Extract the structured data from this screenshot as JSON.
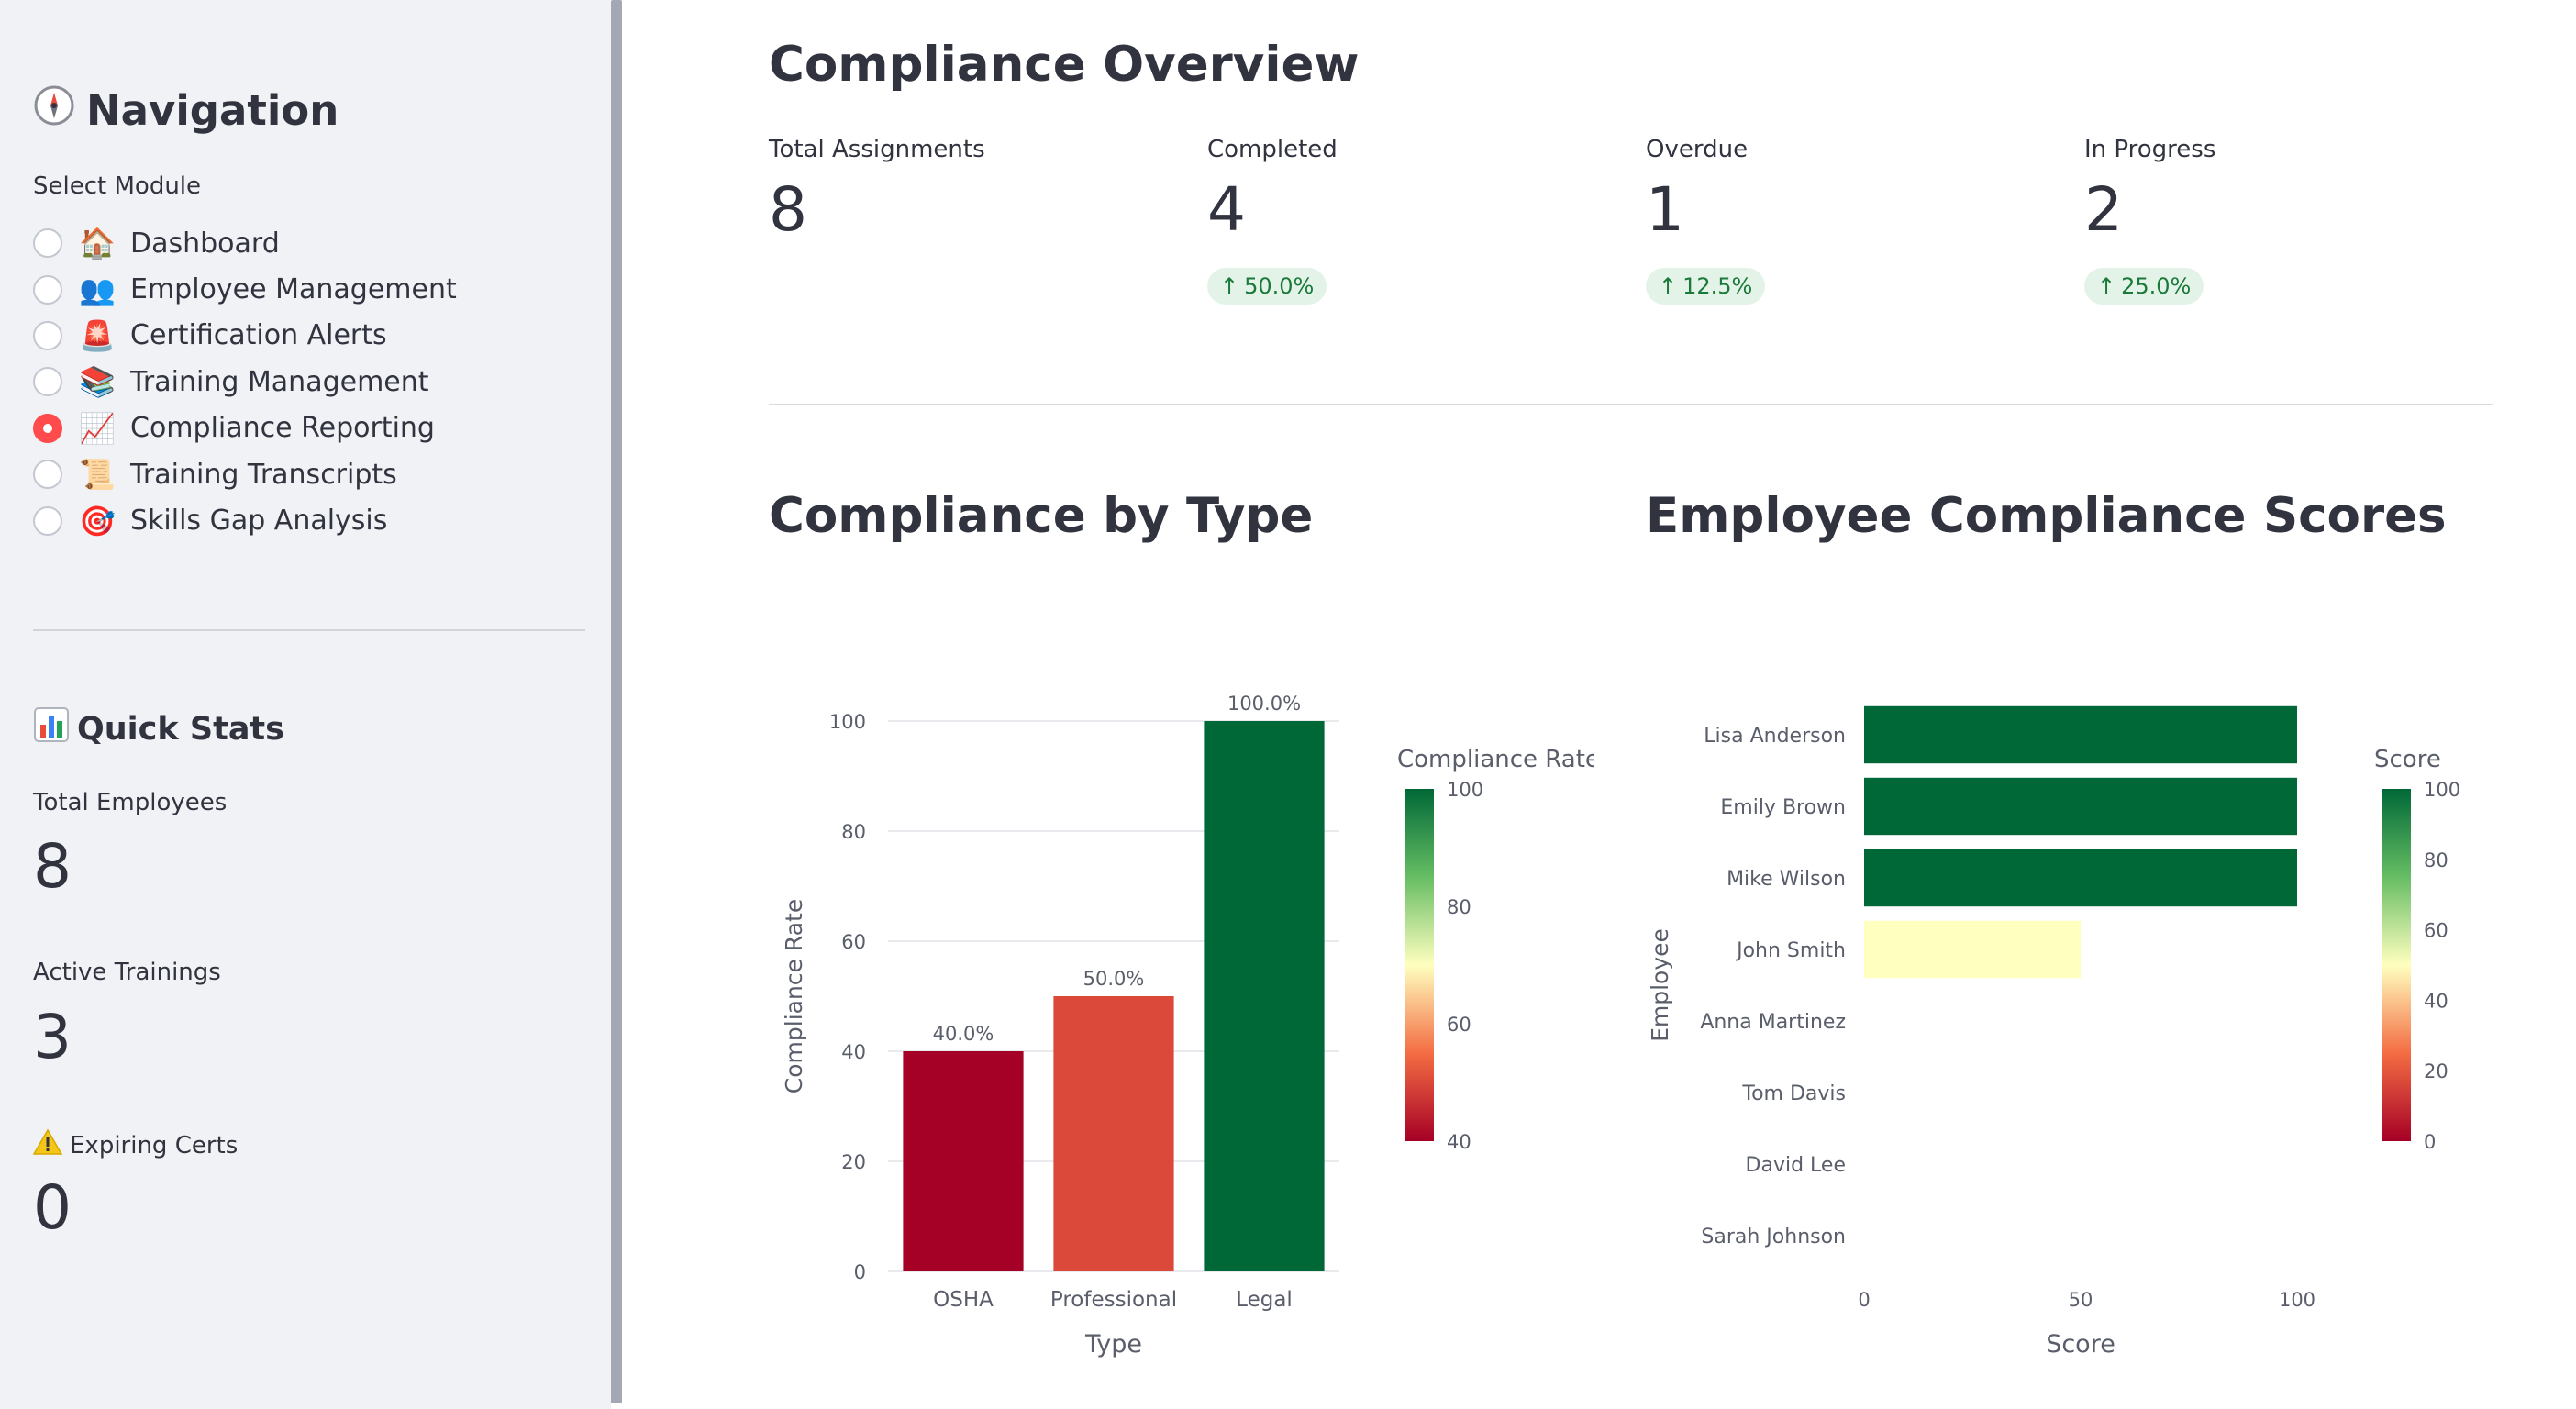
{
  "sidebar": {
    "title": "Navigation",
    "title_icon": "compass-icon",
    "select_label": "Select Module",
    "modules": [
      {
        "label": "Dashboard",
        "icon": "🏠",
        "selected": false
      },
      {
        "label": "Employee Management",
        "icon": "👥",
        "selected": false
      },
      {
        "label": "Certification Alerts",
        "icon": "🚨",
        "selected": false
      },
      {
        "label": "Training Management",
        "icon": "📚",
        "selected": false
      },
      {
        "label": "Compliance Reporting",
        "icon": "📈",
        "selected": true
      },
      {
        "label": "Training Transcripts",
        "icon": "📜",
        "selected": false
      },
      {
        "label": "Skills Gap Analysis",
        "icon": "🎯",
        "selected": false
      }
    ],
    "quick_stats": {
      "title": "Quick Stats",
      "title_icon": "bar-chart-icon",
      "total_employees_label": "Total Employees",
      "total_employees_value": "8",
      "active_trainings_label": "Active Trainings",
      "active_trainings_value": "3",
      "expiring_certs_label": "Expiring Certs",
      "expiring_certs_icon": "warning-icon",
      "expiring_certs_value": "0"
    }
  },
  "main": {
    "title": "Compliance Overview",
    "metrics": [
      {
        "label": "Total Assignments",
        "value": "8",
        "delta": ""
      },
      {
        "label": "Completed",
        "value": "4",
        "delta": "50.0%"
      },
      {
        "label": "Overdue",
        "value": "1",
        "delta": "12.5%"
      },
      {
        "label": "In Progress",
        "value": "2",
        "delta": "25.0%"
      }
    ],
    "section_type_title": "Compliance by Type",
    "section_scores_title": "Employee Compliance Scores"
  },
  "colors": {
    "accent": "#ff4b4b",
    "delta_bg": "#e4f3e8",
    "delta_text": "#1b7a3a"
  },
  "chart_data": [
    {
      "type": "bar",
      "orientation": "vertical",
      "categories": [
        "OSHA",
        "Professional",
        "Legal"
      ],
      "values": [
        40,
        50,
        100
      ],
      "data_labels": [
        "40.0%",
        "50.0%",
        "100.0%"
      ],
      "xlabel": "Type",
      "ylabel": "Compliance Rate",
      "ylim": [
        0,
        100
      ],
      "yticks": [
        0,
        20,
        40,
        60,
        80,
        100
      ],
      "grid": true,
      "colorbar": {
        "title": "Compliance Rate",
        "range": [
          40,
          100
        ],
        "ticks": [
          40,
          60,
          80,
          100
        ],
        "colorscale": "RdYlGn",
        "placement": "right"
      }
    },
    {
      "type": "bar",
      "orientation": "horizontal",
      "categories": [
        "Lisa Anderson",
        "Emily Brown",
        "Mike Wilson",
        "John Smith",
        "Anna Martinez",
        "Tom Davis",
        "David Lee",
        "Sarah Johnson"
      ],
      "values": [
        100,
        100,
        100,
        50,
        0,
        0,
        0,
        0
      ],
      "xlabel": "Score",
      "ylabel": "Employee",
      "xlim": [
        0,
        100
      ],
      "xticks": [
        0,
        50,
        100
      ],
      "grid": false,
      "colorbar": {
        "title": "Score",
        "range": [
          0,
          100
        ],
        "ticks": [
          0,
          20,
          40,
          60,
          80,
          100
        ],
        "colorscale": "RdYlGn",
        "placement": "right"
      }
    }
  ]
}
